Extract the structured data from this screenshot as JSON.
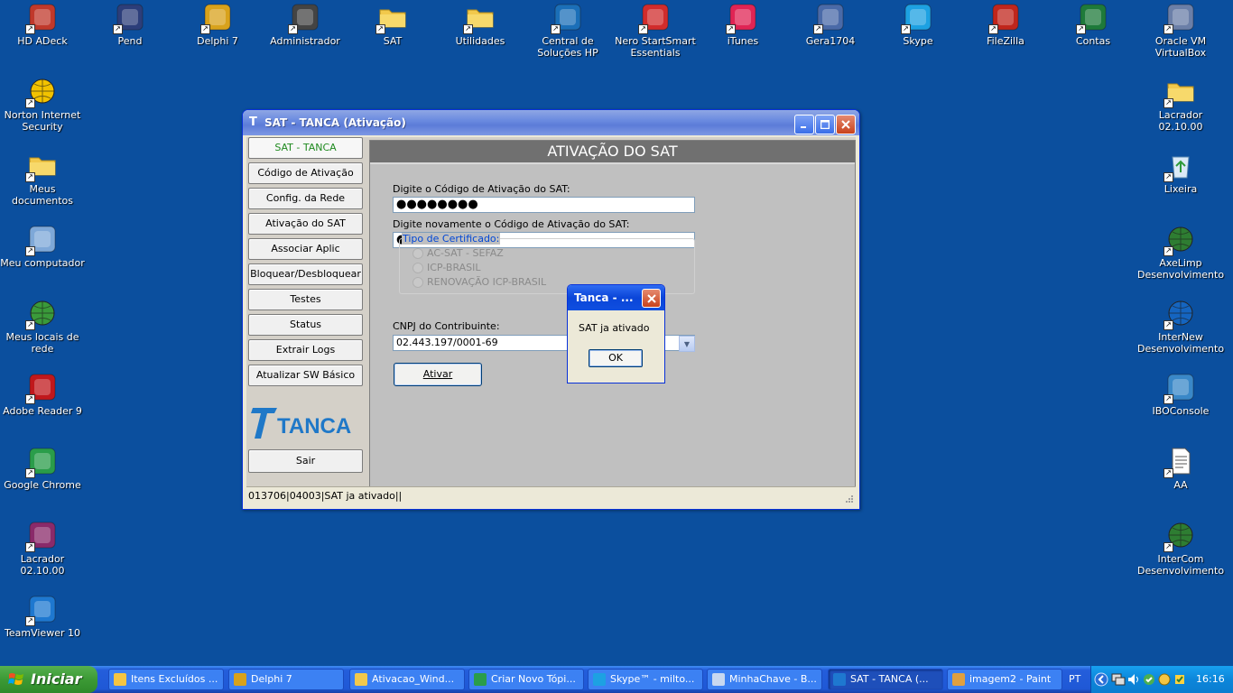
{
  "desktop": {
    "icons_top": [
      {
        "label": "HD ADeck",
        "icon": "hdadeck-icon",
        "color": "#c0392b"
      },
      {
        "label": "Pend",
        "icon": "pend-icon",
        "color": "#2c3e7a"
      },
      {
        "label": "Delphi 7",
        "icon": "delphi-icon",
        "color": "#d8a21c"
      },
      {
        "label": "Administrador",
        "icon": "admin-icon",
        "color": "#444444"
      },
      {
        "label": "SAT",
        "icon": "folder-icon",
        "color": "#f2c94c"
      },
      {
        "label": "Utilidades",
        "icon": "folder-icon",
        "color": "#f2c94c"
      },
      {
        "label": "Central de Soluções HP",
        "icon": "hp-icon",
        "color": "#1b6fb8"
      },
      {
        "label": "Nero StartSmart Essentials",
        "icon": "nero-icon",
        "color": "#d12c2c"
      },
      {
        "label": "iTunes",
        "icon": "itunes-icon",
        "color": "#e02454"
      },
      {
        "label": "Gera1704",
        "icon": "gear-icon",
        "color": "#4a6aa8"
      },
      {
        "label": "Skype",
        "icon": "skype-icon",
        "color": "#1da1e2"
      },
      {
        "label": "FileZilla",
        "icon": "filezilla-icon",
        "color": "#c0261c"
      },
      {
        "label": "Contas",
        "icon": "excel-icon",
        "color": "#1e7a3a"
      },
      {
        "label": "Oracle VM VirtualBox",
        "icon": "virtualbox-icon",
        "color": "#6b7fa8"
      }
    ],
    "icons_left": [
      {
        "label": "Norton Internet Security",
        "icon": "norton-icon",
        "color": "#f2c200"
      },
      {
        "label": "Meus documentos",
        "icon": "documents-icon",
        "color": "#f2c94c"
      },
      {
        "label": "Meu computador",
        "icon": "computer-icon",
        "color": "#7ea8d8"
      },
      {
        "label": "Meus locais de rede",
        "icon": "network-icon",
        "color": "#3a9a3a"
      },
      {
        "label": "Adobe Reader 9",
        "icon": "pdf-icon",
        "color": "#c0181c"
      },
      {
        "label": "Google Chrome",
        "icon": "chrome-icon",
        "color": "#2a9d4a"
      },
      {
        "label": "Lacrador 02.10.00",
        "icon": "winrar-icon",
        "color": "#8a2a6a"
      },
      {
        "label": "TeamViewer 10",
        "icon": "teamviewer-icon",
        "color": "#1e78d0"
      }
    ],
    "icons_right": [
      {
        "label": "Lacrador 02.10.00",
        "icon": "folder-icon",
        "color": "#f2c94c"
      },
      {
        "label": "Lixeira",
        "icon": "recycle-bin-icon",
        "color": "#5aa8d8"
      },
      {
        "label": "AxeLimp Desenvolvimento",
        "icon": "globe-icon",
        "color": "#2e7d32"
      },
      {
        "label": "InterNew Desenvolvimento",
        "icon": "globe-icon",
        "color": "#1565c0"
      },
      {
        "label": "IBOConsole",
        "icon": "ibo-icon",
        "color": "#3a88c8"
      },
      {
        "label": "AA",
        "icon": "text-file-icon",
        "color": "#ffffff"
      },
      {
        "label": "InterCom Desenvolvimento",
        "icon": "globe-icon",
        "color": "#2e7d32"
      }
    ]
  },
  "window": {
    "title": "SAT - TANCA (Ativação)",
    "nav": [
      "SAT - TANCA",
      "Código de Ativação",
      "Config. da Rede",
      "Ativação do SAT",
      "Associar Aplic Comercial",
      "Bloquear/Desbloquear",
      "Testes",
      "Status",
      "Extrair Logs",
      "Atualizar SW Básico"
    ],
    "logo_text": "TANCA",
    "exit_label": "Sair",
    "panel_title": "ATIVAÇÃO DO SAT",
    "code_label": "Digite o Código de Ativação do SAT:",
    "code_value": "●●●●●●●●",
    "code_confirm_label": "Digite novamente o Código de Ativação do SAT:",
    "code_confirm_value": "●●●●●●●●",
    "cert_group_label": "Tipo de Certificado:",
    "cert_options": [
      "AC-SAT - SEFAZ",
      "ICP-BRASIL",
      "RENOVAÇÃO ICP-BRASIL"
    ],
    "cnpj_label": "CNPJ do Contribuinte:",
    "cnpj_value": "02.443.197/0001-69",
    "activate_label": "Ativar",
    "status_text": "013706|04003|SAT ja ativado||"
  },
  "dialog": {
    "title": "Tanca - ...",
    "message": "SAT ja ativado",
    "ok_label": "OK"
  },
  "taskbar": {
    "start_label": "Iniciar",
    "tasks": [
      {
        "label": "Itens Excluídos ...",
        "color": "#f5c542",
        "active": false
      },
      {
        "label": "Delphi 7",
        "color": "#d8a21c",
        "active": false
      },
      {
        "label": "Ativacao_Wind...",
        "color": "#f2c94c",
        "active": false
      },
      {
        "label": "Criar Novo Tópi...",
        "color": "#2a9d4a",
        "active": false
      },
      {
        "label": "Skype™ - milto...",
        "color": "#1da1e2",
        "active": false
      },
      {
        "label": "MinhaChave - B...",
        "color": "#c8d8f0",
        "active": false
      },
      {
        "label": "SAT - TANCA (...",
        "color": "#1e78d0",
        "active": true
      },
      {
        "label": "imagem2 - Paint",
        "color": "#e0a040",
        "active": false
      }
    ],
    "language": "PT",
    "clock": "16:16"
  }
}
